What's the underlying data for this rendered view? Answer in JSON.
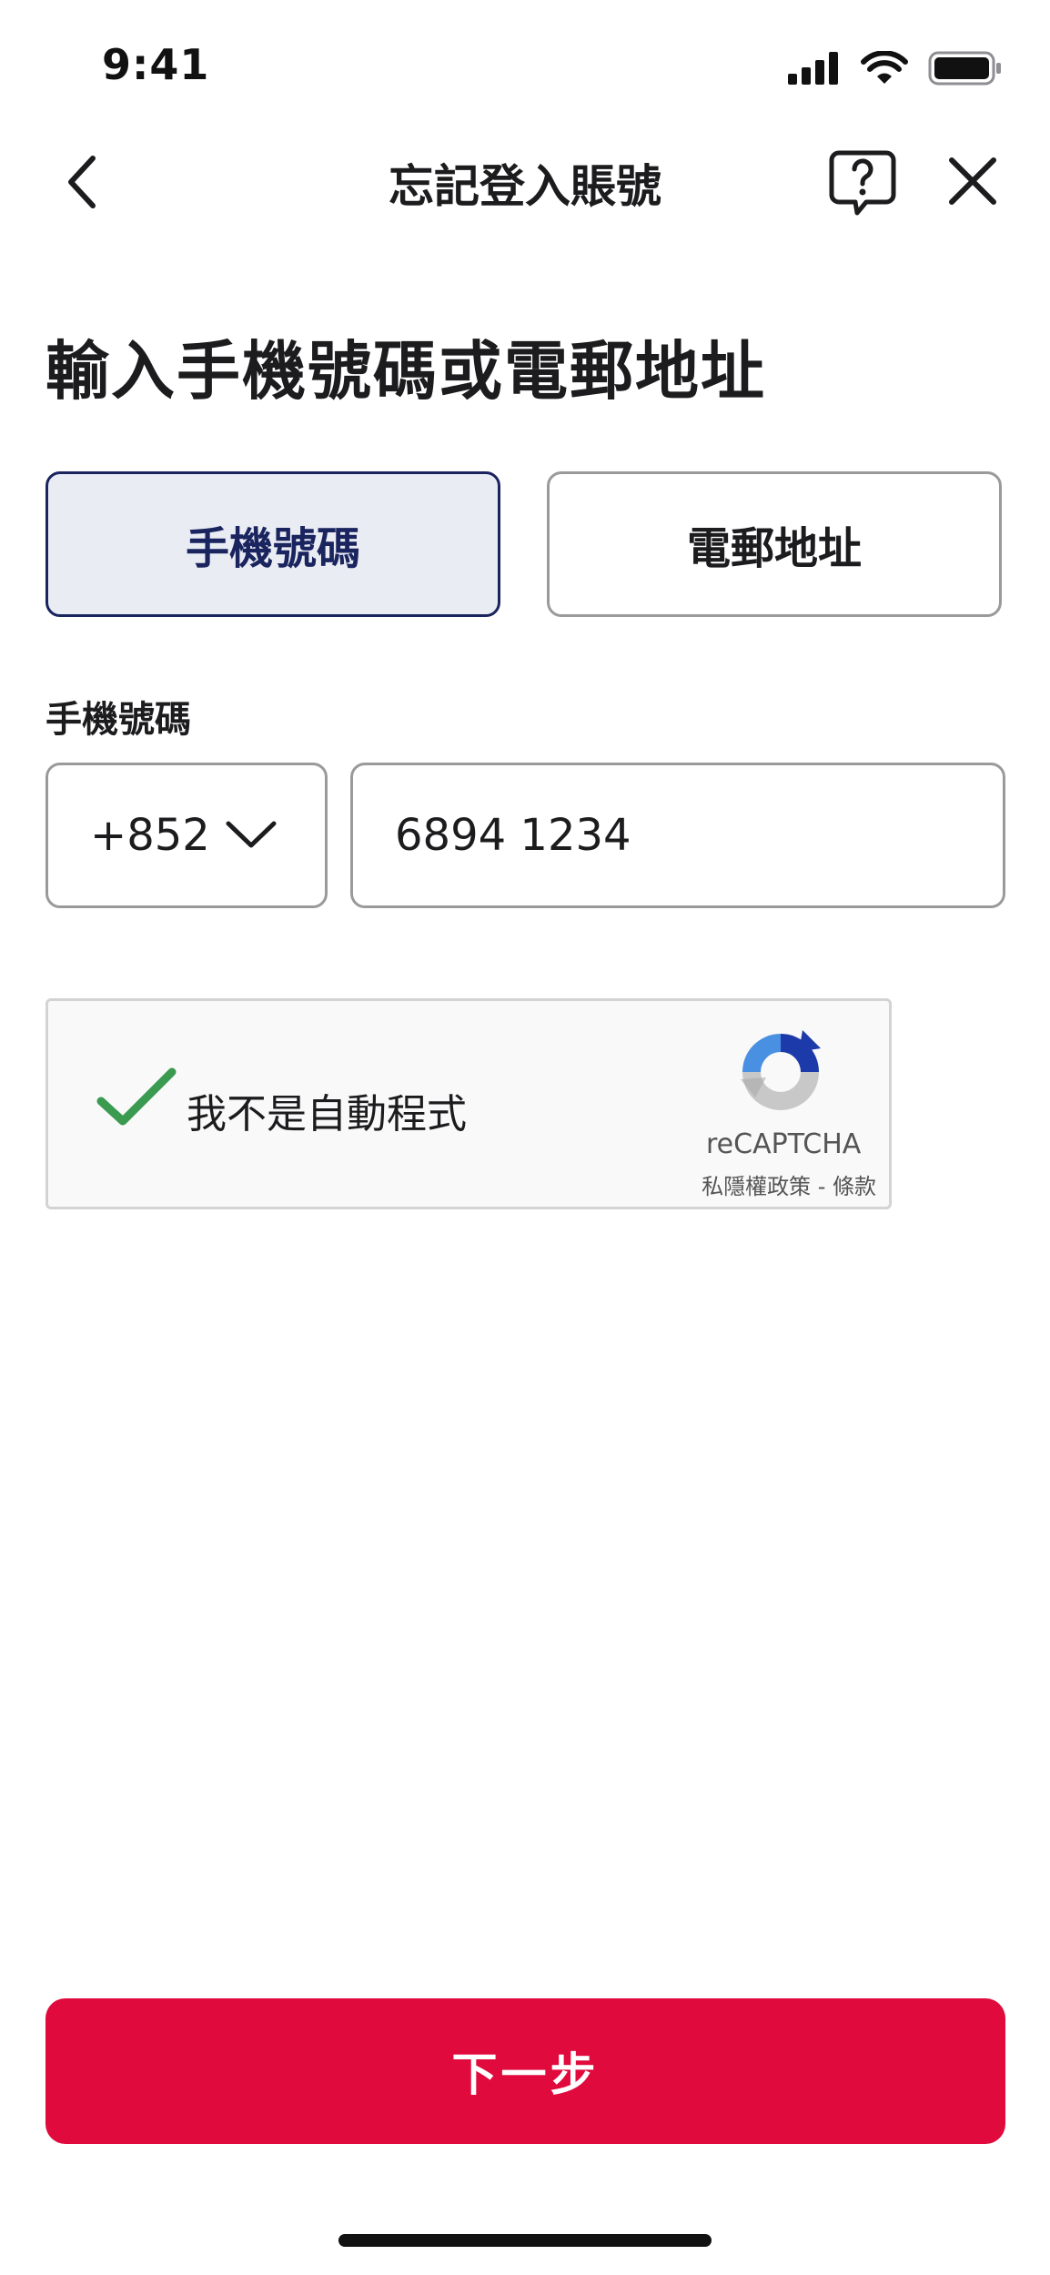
{
  "status_bar": {
    "time": "9:41",
    "icons": [
      "signal-icon",
      "wifi-icon",
      "battery-icon"
    ]
  },
  "nav": {
    "title": "忘記登入賬號",
    "back_icon": "chevron-left-icon",
    "help_icon": "help-icon",
    "close_icon": "close-icon"
  },
  "heading": "輸入手機號碼或電郵地址",
  "tabs": [
    {
      "label": "手機號碼",
      "selected": true
    },
    {
      "label": "電郵地址",
      "selected": false
    }
  ],
  "phone_field": {
    "label": "手機號碼",
    "country_code": "+852",
    "value": "6894 1234"
  },
  "captcha": {
    "label": "我不是自動程式",
    "checked": true,
    "brand": "reCAPTCHA",
    "links": "私隱權政策 - 條款"
  },
  "primary_button": {
    "label": "下一步"
  },
  "colors": {
    "accent": "#e00a3d",
    "selected_tab_bg": "#eaecf3",
    "selected_tab_border": "#1a245e",
    "border": "#9a9a9a"
  }
}
